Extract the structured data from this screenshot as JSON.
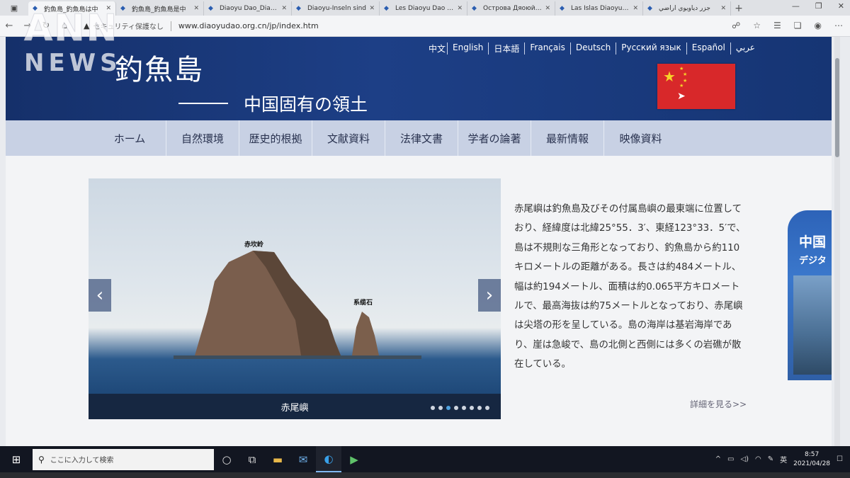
{
  "watermark": {
    "top": "ANN",
    "bottom": "NEWS"
  },
  "browser": {
    "tabs": [
      {
        "title": "釣魚島_釣魚島は中",
        "active": true
      },
      {
        "title": "釣魚島_釣魚島是中",
        "active": false
      },
      {
        "title": "Diaoyu Dao_Diaoyu",
        "active": false
      },
      {
        "title": "Diaoyu-Inseln sind",
        "active": false
      },
      {
        "title": "Les Diaoyu Dao – L",
        "active": false
      },
      {
        "title": "Острова Дяоюйда",
        "active": false
      },
      {
        "title": "Las Islas Diaoyu, te",
        "active": false
      },
      {
        "title": "جزر دياويوي أراضي",
        "active": false
      }
    ],
    "security_text": "セキュリティ保護なし",
    "url": "www.diaoyudao.org.cn/jp/index.htm"
  },
  "site": {
    "logo": "釣魚島",
    "tagline": "中国固有の領土",
    "languages": [
      "中文",
      "English",
      "日本語",
      "Français",
      "Deutsch",
      "Русский язык",
      "Español",
      "عربي"
    ],
    "nav": [
      "ホーム",
      "自然環境",
      "歴史的根拠",
      "文献資料",
      "法律文書",
      "学者の論著",
      "最新情報",
      "映像資料"
    ],
    "slider": {
      "labels": {
        "peak": "赤坎岭",
        "rock": "系缆石"
      },
      "caption": "赤尾嶼",
      "dot_count": 8,
      "active_dot": 2
    },
    "description": "赤尾嶼は釣魚島及びその付属島嶼の最東端に位置しており、経緯度は北緯25°55．3′、東経123°33．5′で、島は不規則な三角形となっており、釣魚島から約110キロメートルの距離がある。長さは約484メートル、幅は約194メートル、面積は約0.065平方キロメートルで、最高海抜は約75メートルとなっており、赤尾嶼は尖塔の形を呈している。島の海岸は基岩海岸であり、崖は急峻で、島の北側と西側には多くの岩礁が散在している。",
    "more_link": "詳細を見る>>",
    "promo": {
      "line1": "中国",
      "line2": "デジタ"
    }
  },
  "taskbar": {
    "search_placeholder": "ここに入力して検索",
    "ime": "英",
    "time": "8:57",
    "date": "2021/04/28"
  }
}
